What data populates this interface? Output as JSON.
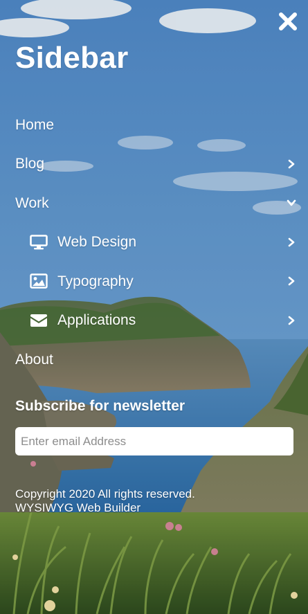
{
  "colors": {
    "text": "#ffffff",
    "sky": "#4c86c4",
    "sea": "#3a79b1",
    "foliage": "#3f6b2d"
  },
  "sidebar": {
    "title": "Sidebar",
    "close_icon": "close-icon",
    "items": [
      {
        "label": "Home",
        "icon": null,
        "chevron": null
      },
      {
        "label": "Blog",
        "icon": null,
        "chevron": "chevron-right-icon"
      },
      {
        "label": "Work",
        "icon": null,
        "chevron": "chevron-down-icon"
      },
      {
        "label": "Web Design",
        "icon": "desktop-icon",
        "chevron": "chevron-right-icon"
      },
      {
        "label": "Typography",
        "icon": "image-icon",
        "chevron": "chevron-right-icon"
      },
      {
        "label": "Applications",
        "icon": "envelope-icon",
        "chevron": "chevron-right-icon"
      },
      {
        "label": "About",
        "icon": null,
        "chevron": null
      }
    ]
  },
  "newsletter": {
    "heading": "Subscribe for newsletter",
    "email_placeholder": "Enter email Address",
    "email_value": ""
  },
  "footer": {
    "line1": "Copyright 2020 All rights reserved.",
    "line2": "WYSIWYG Web Builder"
  }
}
